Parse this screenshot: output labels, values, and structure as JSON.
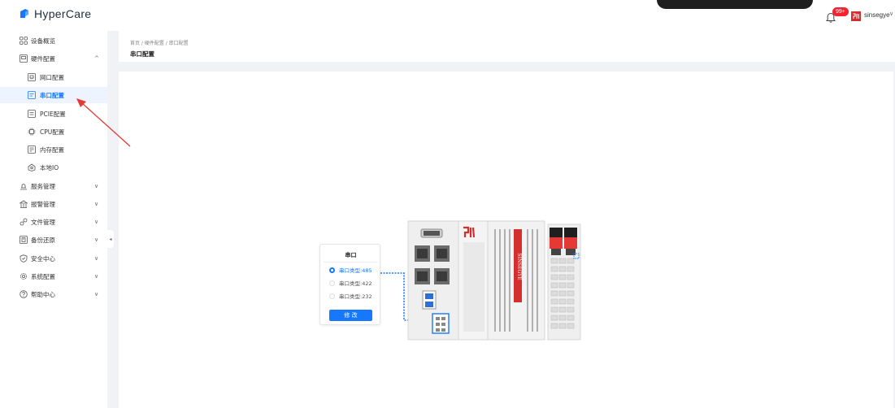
{
  "header": {
    "app_name": "HyperCare",
    "notification_badge": "99+",
    "user_name": "sinsegye",
    "user_caret": "∨"
  },
  "sidebar": {
    "items": [
      {
        "label": "设备概览",
        "icon": "grid-icon",
        "caret": ""
      },
      {
        "label": "硬件配置",
        "icon": "hardware-icon",
        "caret": "^"
      },
      {
        "label": "网口配置",
        "icon": "ethernet-icon",
        "caret": "",
        "sub": true
      },
      {
        "label": "串口配置",
        "icon": "serial-port-icon",
        "caret": "",
        "sub": true,
        "active": true
      },
      {
        "label": "PCIE配置",
        "icon": "pcie-icon",
        "caret": "",
        "sub": true
      },
      {
        "label": "CPU配置",
        "icon": "cpu-icon",
        "caret": "",
        "sub": true
      },
      {
        "label": "内存配置",
        "icon": "memory-icon",
        "caret": "",
        "sub": true
      },
      {
        "label": "本地IO",
        "icon": "local-io-icon",
        "caret": "",
        "sub": true
      },
      {
        "label": "服务管理",
        "icon": "service-icon",
        "caret": "∨"
      },
      {
        "label": "报警管理",
        "icon": "alarm-icon",
        "caret": "∨"
      },
      {
        "label": "文件管理",
        "icon": "file-icon",
        "caret": "∨"
      },
      {
        "label": "备份还原",
        "icon": "backup-icon",
        "caret": "∨"
      },
      {
        "label": "安全中心",
        "icon": "shield-icon",
        "caret": "∨"
      },
      {
        "label": "系统配置",
        "icon": "gear-icon",
        "caret": "∨"
      },
      {
        "label": "帮助中心",
        "icon": "help-icon",
        "caret": "∨"
      }
    ],
    "collapse_glyph": "◂"
  },
  "breadcrumb": {
    "path": "首页 / 硬件配置 / 串口配置",
    "title": "串口配置"
  },
  "serial_panel": {
    "title": "串口",
    "options": [
      {
        "label": "串口类型:485",
        "checked": true
      },
      {
        "label": "串口类型:422",
        "checked": false
      },
      {
        "label": "串口类型:232",
        "checked": false
      }
    ],
    "modify_label": "修 改"
  },
  "device": {
    "brand_text": "SINSEGYE",
    "logo_text": "Sil"
  },
  "colors": {
    "accent": "#1677ff",
    "alert": "#f5222d",
    "arrow": "#e53935"
  }
}
